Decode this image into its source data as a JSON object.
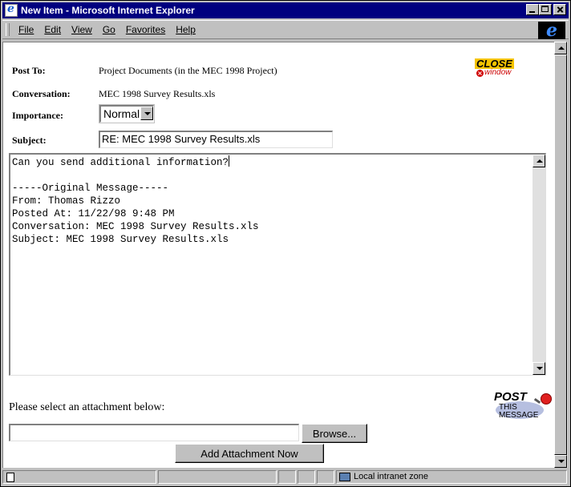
{
  "window": {
    "title": "New Item - Microsoft Internet Explorer"
  },
  "menu": {
    "items": [
      "File",
      "Edit",
      "View",
      "Go",
      "Favorites",
      "Help"
    ]
  },
  "form": {
    "post_to_label": "Post To:",
    "post_to_value": "Project Documents (in the MEC 1998 Project)",
    "conversation_label": "Conversation:",
    "conversation_value": "MEC 1998 Survey Results.xls",
    "importance_label": "Importance:",
    "importance_value": "Normal",
    "subject_label": "Subject:",
    "subject_value": "RE: MEC 1998 Survey Results.xls",
    "body_lines": [
      "Can you send additional information?",
      "",
      "-----Original Message-----",
      "From: Thomas Rizzo",
      "Posted At: 11/22/98 9:48 PM",
      "Conversation: MEC 1998 Survey Results.xls",
      "Subject: MEC 1998 Survey Results.xls"
    ],
    "attachment_prompt": "Please select an attachment below:",
    "attachment_path": "",
    "browse_label": "Browse...",
    "add_attachment_label": "Add Attachment Now"
  },
  "close_logo": {
    "big": "CLOSE",
    "small": "window"
  },
  "post_logo": {
    "big": "POST",
    "line2": "THIS",
    "line3": "MESSAGE"
  },
  "status": {
    "zone": "Local intranet zone"
  }
}
